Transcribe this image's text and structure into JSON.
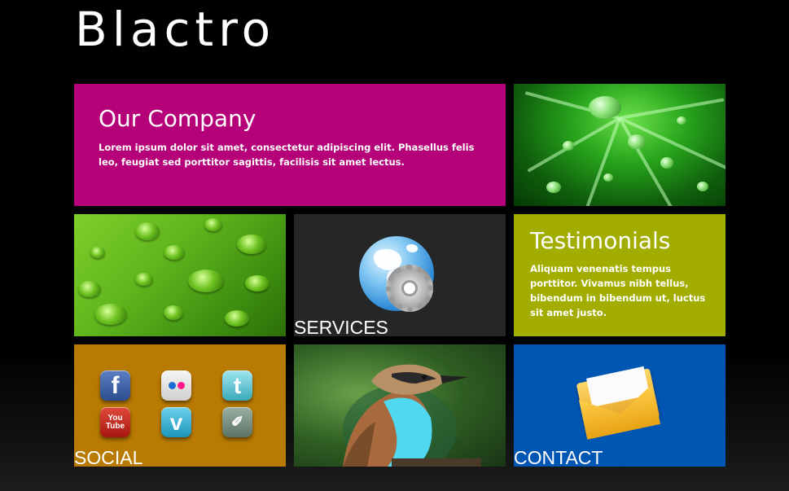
{
  "site": {
    "logo": "Blactro"
  },
  "tiles": {
    "company": {
      "title": "Our Company",
      "text": "Lorem ipsum dolor sit amet, consectetur adipiscing elit. Phasellus felis leo, feugiat sed porttitor sagittis, facilisis sit amet lectus.",
      "color": "#b5007a"
    },
    "services": {
      "caption": "SERVICES",
      "icon": "globe-gear-icon",
      "color": "#262626"
    },
    "testimonials": {
      "title": "Testimonials",
      "text": "Aliquam venenatis tempus porttitor. Vivamus nibh tellus, bibendum in bibendum ut, luctus sit amet justo.",
      "color": "#a3ad00"
    },
    "social": {
      "caption": "SOCIAL",
      "color": "#b87a00",
      "icons": [
        "facebook-icon",
        "flickr-icon",
        "twitter-icon",
        "youtube-icon",
        "vimeo-icon",
        "deviantart-icon"
      ],
      "youtube_text": "You Tube"
    },
    "contact": {
      "caption": "CONTACT",
      "icon": "envelope-icon",
      "color": "#0056b3"
    },
    "photos": [
      "leaf-water-drops-photo",
      "leaf-droplets-photo",
      "bird-photo"
    ]
  }
}
